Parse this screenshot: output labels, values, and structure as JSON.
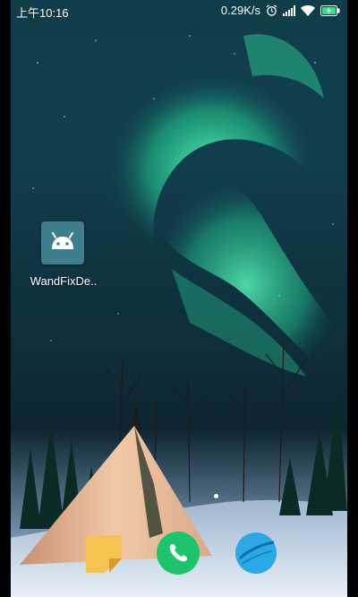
{
  "status_bar": {
    "time": "上午10:16",
    "net_speed": "0.29K/s",
    "icons": [
      "alarm-icon",
      "signal-icon",
      "wifi-icon",
      "battery-charging-icon"
    ]
  },
  "home": {
    "apps": [
      {
        "label": "WandFixDe..",
        "icon": "android-icon"
      }
    ]
  },
  "dock": {
    "apps": [
      "notes-icon",
      "phone-icon",
      "browser-icon"
    ]
  },
  "colors": {
    "aurora": "#2ee6a0",
    "sky": "#0f3d4a",
    "app_tile": "#3d7f8c",
    "phone_green": "#1dc46b",
    "notes_yellow": "#f6c353",
    "browser_blue": "#2aa9e6"
  }
}
